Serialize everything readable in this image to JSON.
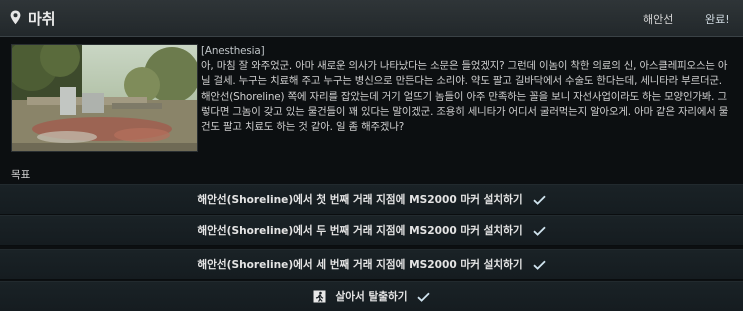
{
  "header": {
    "title": "마취",
    "trader": "해안선",
    "status": "완료!"
  },
  "description": {
    "tag": "[Anesthesia]",
    "text": "아, 마침 잘 와주었군. 아마 새로운 의사가 나타났다는 소문은 들었겠지? 그런데 이놈이 착한 의료의 신, 아스클레피오스는 아닐 걸세. 누구는 치료해 주고 누구는 병신으로 만든다는 소리야. 약도 팔고 길바닥에서 수술도 한다는데, 세니타라 부르더군. 해안선(Shoreline) 쪽에 자리를 잡았는데 거기 얼뜨기 놈들이 아주 만족하는 꼴을 보니 자선사업이라도 하는 모양인가봐. 그렇다면 그놈이 갖고 있는 물건들이 꽤 있다는 말이겠군. 조용히 세니타가 어디서 굴러먹는지 알아오게. 아마 같은 자리에서 물건도 팔고 치료도 하는 것 같아. 일 좀 해주겠나?"
  },
  "objectives": {
    "label": "목표",
    "items": [
      {
        "text": "해안선(Shoreline)에서 첫 번째 거래 지점에 MS2000 마커 설치하기",
        "icon": "check-icon",
        "completed": true
      },
      {
        "text": "해안선(Shoreline)에서 두 번째 거래 지점에 MS2000 마커 설치하기",
        "icon": "check-icon",
        "completed": true
      },
      {
        "text": "해안선(Shoreline)에서 세 번째 거래 지점에 MS2000 마커 설치하기",
        "icon": "check-icon",
        "completed": true
      },
      {
        "text": "살아서 탈출하기",
        "icon": "exit-icon",
        "completed": true
      }
    ]
  },
  "colors": {
    "check": "#cfe3ee",
    "header_bg": "#2a3033",
    "row_bg": "#182024"
  }
}
